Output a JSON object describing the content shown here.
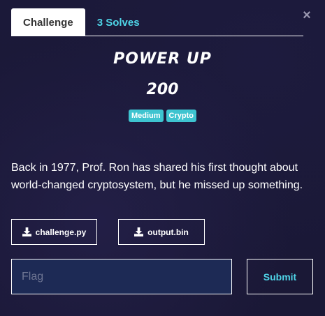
{
  "tabs": [
    {
      "label": "Challenge",
      "active": true
    },
    {
      "label": "3 Solves",
      "active": false
    }
  ],
  "close_icon": "close-icon",
  "challenge": {
    "name": "Power Up",
    "value": "200",
    "tags": [
      "Medium",
      "Crypto"
    ],
    "description": "Back in 1977, Prof. Ron has shared his first thought about world-changed cryptosystem, but he missed up something."
  },
  "files": [
    {
      "name": "challenge.py",
      "icon": "download-icon"
    },
    {
      "name": "output.bin",
      "icon": "download-icon"
    }
  ],
  "flag_form": {
    "placeholder": "Flag",
    "value": "",
    "submit_label": "Submit"
  },
  "colors": {
    "background": "#1a1838",
    "accent": "#4fd5e8",
    "tag_bg": "#3ec4d0",
    "input_bg": "#1d2a55"
  }
}
